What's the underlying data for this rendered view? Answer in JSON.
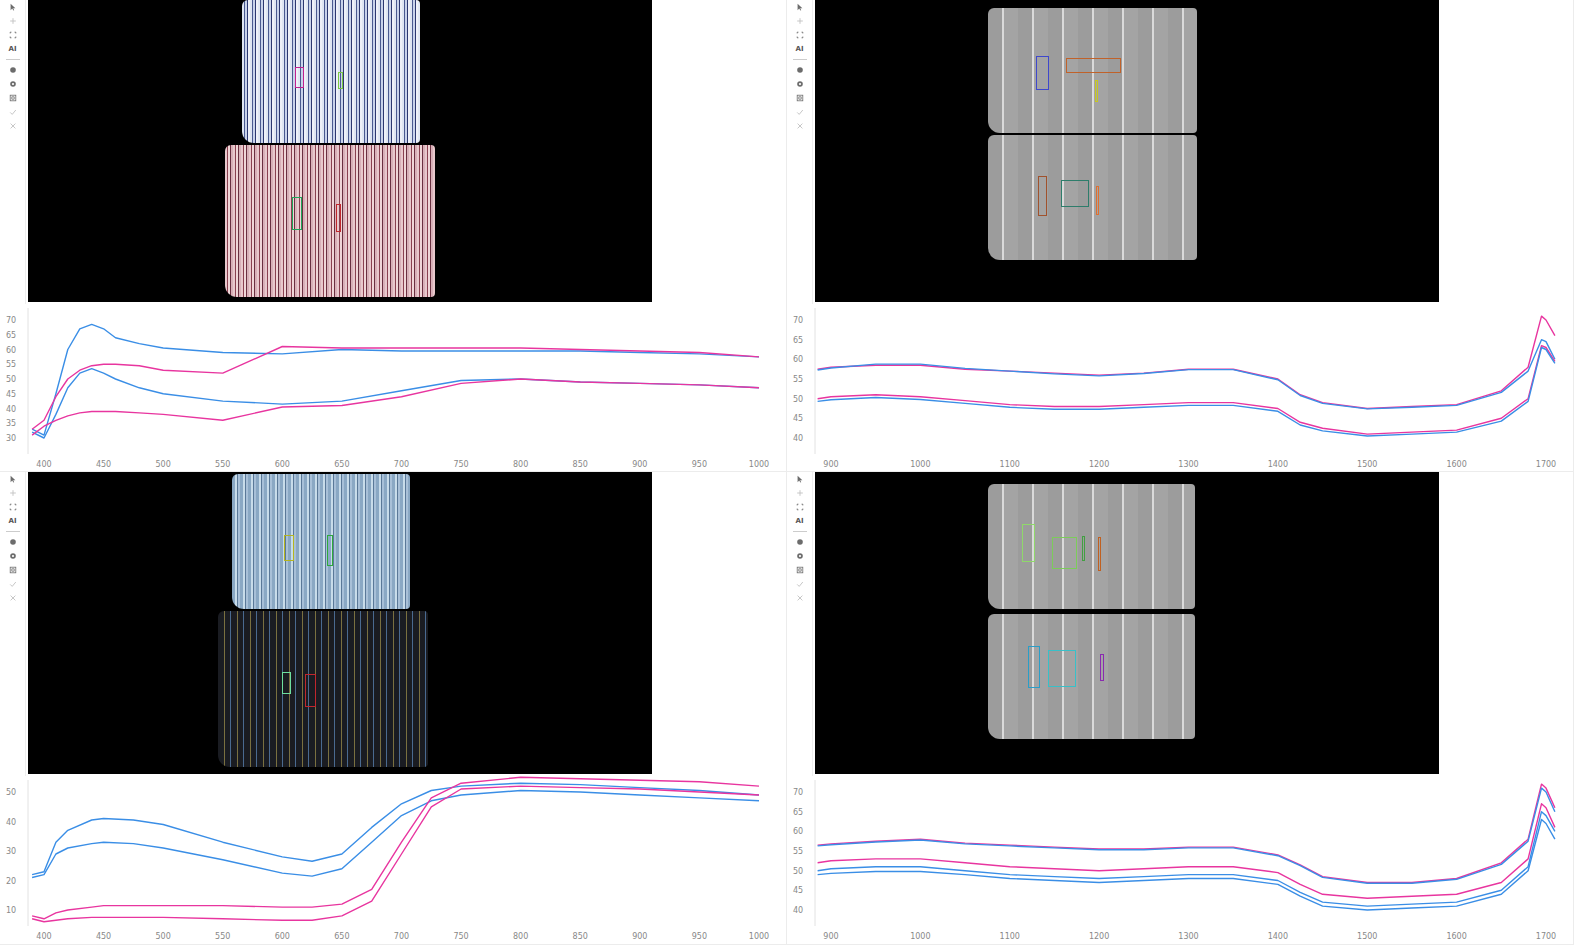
{
  "toolbar": [
    {
      "kind": "tool",
      "disabled": false
    },
    {
      "kind": "tool",
      "disabled": true
    },
    {
      "kind": "tool",
      "disabled": false
    },
    {
      "kind": "label",
      "text": "AI",
      "disabled": false
    },
    {
      "kind": "separator",
      "disabled": false
    },
    {
      "kind": "tool",
      "disabled": false
    },
    {
      "kind": "tool",
      "disabled": false
    },
    {
      "kind": "tool",
      "disabled": false
    },
    {
      "kind": "tool",
      "disabled": true
    },
    {
      "kind": "tool",
      "disabled": true
    }
  ],
  "panels": [
    {
      "rois": [
        {
          "color": "#c0208f"
        },
        {
          "color": "#7ac943"
        },
        {
          "color": "#1fa65a"
        },
        {
          "color": "#c0272d"
        }
      ],
      "chart": {
        "x_ticks": [
          "400",
          "450",
          "500",
          "550",
          "600",
          "650",
          "700",
          "750",
          "800",
          "850",
          "900",
          "950",
          "1000"
        ],
        "y_ticks": [
          "30",
          "35",
          "40",
          "45",
          "50",
          "55",
          "60",
          "65",
          "70"
        ],
        "x": [
          390,
          400,
          410,
          420,
          430,
          440,
          450,
          460,
          480,
          500,
          550,
          600,
          650,
          700,
          750,
          800,
          850,
          900,
          950,
          1000
        ],
        "series": [
          {
            "color": "#3a8ee6",
            "values": [
              33,
              31,
              45,
              60,
              67,
              68.5,
              67,
              64,
              62,
              60.5,
              59,
              58.5,
              60,
              59.5,
              59.5,
              59.5,
              59.5,
              59,
              58.5,
              57.5
            ]
          },
          {
            "color": "#3a8ee6",
            "values": [
              32,
              30,
              38,
              47,
              52,
              53.5,
              52,
              50,
              47,
              45,
              42.5,
              41.5,
              42.5,
              46,
              49.5,
              50,
              49,
              48.5,
              48,
              47
            ]
          },
          {
            "color": "#e8359f",
            "values": [
              33,
              36,
              44,
              50,
              53,
              54.5,
              55,
              55,
              54.5,
              53,
              52,
              61,
              60.5,
              60.5,
              60.5,
              60.5,
              60,
              59.5,
              59,
              57.5
            ]
          },
          {
            "color": "#e8359f",
            "values": [
              31,
              34,
              36,
              37.5,
              38.5,
              39,
              39,
              39,
              38.5,
              38,
              36,
              40.5,
              41,
              44,
              48.5,
              50,
              49,
              48.5,
              48,
              47
            ]
          }
        ]
      }
    },
    {
      "rois": [
        {
          "color": "#3f48cc"
        },
        {
          "color": "#c0622a"
        },
        {
          "color": "#c8c820"
        },
        {
          "color": "#a0522d"
        },
        {
          "color": "#2e7d6b"
        },
        {
          "color": "#e07030"
        }
      ],
      "chart": {
        "x_ticks": [
          "900",
          "1000",
          "1100",
          "1200",
          "1300",
          "1400",
          "1500",
          "1600",
          "1700"
        ],
        "y_ticks": [
          "40",
          "45",
          "50",
          "55",
          "60",
          "65",
          "70"
        ],
        "x": [
          885,
          900,
          950,
          1000,
          1050,
          1100,
          1150,
          1200,
          1250,
          1300,
          1350,
          1400,
          1425,
          1450,
          1500,
          1550,
          1600,
          1650,
          1680,
          1695,
          1700,
          1710
        ],
        "series": [
          {
            "color": "#e8359f",
            "values": [
              57.5,
              58,
              58.5,
              58.5,
              57.5,
              57,
              56.5,
              56,
              56.5,
              57.5,
              57.5,
              55,
              51,
              49,
              47.5,
              48,
              48.5,
              52,
              58,
              71,
              70,
              66
            ]
          },
          {
            "color": "#3a8ee6",
            "values": [
              57.3,
              57.8,
              58.8,
              58.8,
              57.7,
              57,
              56.3,
              55.8,
              56.4,
              57.4,
              57.4,
              54.8,
              50.8,
              48.8,
              47.4,
              47.8,
              48.3,
              51.6,
              57,
              65,
              64.5,
              60
            ]
          },
          {
            "color": "#e8359f",
            "values": [
              50,
              50.5,
              51,
              50.5,
              49.5,
              48.5,
              48,
              48,
              48.5,
              49,
              49,
              47.5,
              44,
              42.5,
              41,
              41.5,
              42,
              45,
              50,
              63.5,
              63,
              59.5
            ]
          },
          {
            "color": "#3a8ee6",
            "values": [
              49.3,
              49.7,
              50.3,
              49.8,
              48.8,
              47.8,
              47.3,
              47.3,
              47.8,
              48.3,
              48.3,
              46.8,
              43.3,
              41.8,
              40.5,
              41,
              41.5,
              44.3,
              49.3,
              63,
              62.5,
              59
            ]
          }
        ]
      }
    },
    {
      "rois": [
        {
          "color": "#b5b520"
        },
        {
          "color": "#2eaa3c"
        },
        {
          "color": "#6ee0a0"
        },
        {
          "color": "#c0272d"
        }
      ],
      "chart": {
        "x_ticks": [
          "400",
          "450",
          "500",
          "550",
          "600",
          "650",
          "700",
          "750",
          "800",
          "850",
          "900",
          "950",
          "1000"
        ],
        "y_ticks": [
          "10",
          "20",
          "30",
          "40",
          "50"
        ],
        "x": [
          390,
          400,
          410,
          420,
          440,
          450,
          475,
          500,
          550,
          600,
          625,
          650,
          675,
          700,
          725,
          750,
          800,
          850,
          900,
          950,
          1000
        ],
        "series": [
          {
            "color": "#3a8ee6",
            "values": [
              22,
              23,
              33,
              37,
              40.5,
              41,
              40.5,
              39,
              33,
              28,
              26.5,
              29,
              38,
              46,
              50.5,
              52,
              53,
              52.5,
              51.5,
              50.5,
              49
            ]
          },
          {
            "color": "#3a8ee6",
            "values": [
              21,
              22,
              29,
              31,
              32.5,
              33,
              32.5,
              31,
              27,
              22.5,
              21.5,
              24,
              33,
              42,
              47,
              49,
              50.5,
              50,
              49,
              48,
              47
            ]
          },
          {
            "color": "#e8359f",
            "values": [
              8,
              7,
              9,
              10,
              11,
              11.5,
              11.5,
              11.5,
              11.5,
              11,
              11,
              12,
              17,
              33,
              48,
              53,
              55,
              54.5,
              54,
              53.5,
              52
            ]
          },
          {
            "color": "#e8359f",
            "values": [
              7,
              6,
              6.5,
              7,
              7.5,
              7.5,
              7.5,
              7.5,
              7,
              6.5,
              6.5,
              8,
              13,
              29,
              45,
              51,
              52,
              51.5,
              51,
              50,
              49
            ]
          }
        ]
      }
    },
    {
      "rois": [
        {
          "color": "#8fd86a"
        },
        {
          "color": "#7ccc5a"
        },
        {
          "color": "#40a040"
        },
        {
          "color": "#c06020"
        },
        {
          "color": "#2a9ec8"
        },
        {
          "color": "#38c0c8"
        },
        {
          "color": "#8a2ab0"
        }
      ],
      "chart": {
        "x_ticks": [
          "900",
          "1000",
          "1100",
          "1200",
          "1300",
          "1400",
          "1500",
          "1600",
          "1700"
        ],
        "y_ticks": [
          "40",
          "45",
          "50",
          "55",
          "60",
          "65",
          "70"
        ],
        "x": [
          885,
          900,
          950,
          1000,
          1050,
          1100,
          1150,
          1200,
          1250,
          1300,
          1350,
          1400,
          1425,
          1450,
          1500,
          1550,
          1600,
          1650,
          1680,
          1695,
          1700,
          1710
        ],
        "series": [
          {
            "color": "#e8359f",
            "values": [
              56.5,
              56.8,
              57.5,
              58,
              57,
              56.5,
              56,
              55.5,
              55.5,
              56,
              56,
              54,
              51.5,
              48.5,
              47,
              47,
              48,
              52,
              58,
              72,
              71,
              66
            ]
          },
          {
            "color": "#3a8ee6",
            "values": [
              56.3,
              56.6,
              57.3,
              57.8,
              56.8,
              56.3,
              55.8,
              55.3,
              55.3,
              55.8,
              55.8,
              53.8,
              51.3,
              48.3,
              46.8,
              46.8,
              47.8,
              51.6,
              57.5,
              71,
              70,
              65
            ]
          },
          {
            "color": "#e8359f",
            "values": [
              52,
              52.5,
              53,
              53,
              52,
              51,
              50.5,
              50,
              50.5,
              51,
              51,
              49.5,
              46.5,
              44,
              43,
              43.5,
              44,
              47,
              53,
              67,
              66,
              61
            ]
          },
          {
            "color": "#3a8ee6",
            "values": [
              50,
              50.5,
              51,
              51,
              50,
              49,
              48.5,
              48,
              48.5,
              49,
              49,
              47.5,
              44.5,
              42,
              41,
              41.5,
              42,
              45,
              51,
              65,
              64,
              60
            ]
          },
          {
            "color": "#3a8ee6",
            "values": [
              49,
              49.3,
              49.8,
              49.8,
              49,
              48,
              47.5,
              47,
              47.5,
              48,
              48,
              46.5,
              43.5,
              41,
              40,
              40.5,
              41,
              44,
              50,
              63,
              62,
              58
            ]
          }
        ]
      }
    }
  ]
}
